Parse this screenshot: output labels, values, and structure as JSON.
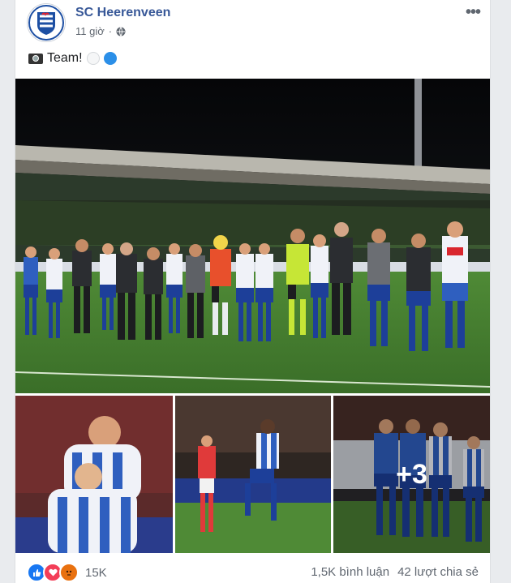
{
  "post": {
    "page_name": "SC Heerenveen",
    "time": "11 giờ",
    "privacy_icon": "globe-icon",
    "caption": "Team!",
    "caption_icons": [
      "camera-icon",
      "white-circle-icon",
      "blue-circle-icon"
    ]
  },
  "photos": {
    "extra_count": "+3"
  },
  "footer": {
    "reactions": [
      "like-icon",
      "love-icon",
      "angry-icon"
    ],
    "reaction_count": "15K",
    "comments": "1,5K bình luận",
    "shares": "42 lượt chia sẻ"
  },
  "colors": {
    "link_blue": "#385898",
    "like_blue": "#1877f2",
    "love_red": "#f33e58",
    "angry_orange": "#e9710f"
  }
}
